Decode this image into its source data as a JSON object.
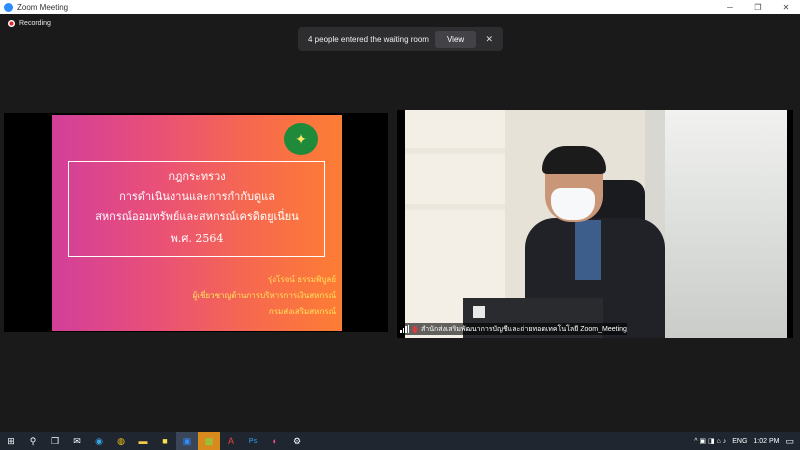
{
  "window": {
    "title": "Zoom Meeting",
    "controls": [
      "─",
      "❐",
      "✕"
    ]
  },
  "recording": {
    "label": "Recording"
  },
  "toast": {
    "message": "4 people entered the waiting room",
    "view_label": "View",
    "close_label": "✕"
  },
  "slide": {
    "logo_glyph": "✦",
    "title_lines": [
      "กฎกระทรวง",
      "การดำเนินงานและการกำกับดูแล",
      "สหกรณ์ออมทรัพย์และสหกรณ์เครดิตยูเนี่ยน",
      "พ.ศ. 2564"
    ],
    "signature_lines": [
      "รุ่งโรจน์ ธรรมพิบูลย์",
      "ผู้เชี่ยวชาญด้านการบริหารการเงินสหกรณ์",
      "กรมส่งเสริมสหกรณ์"
    ]
  },
  "participant": {
    "name": "สำนักส่งเสริมพัฒนาการบัญชีและถ่ายทอดเทคโนโลยี Zoom_Meeting"
  },
  "taskbar": {
    "apps": [
      {
        "icon": "windows-start-icon",
        "glyph": "⊞"
      },
      {
        "icon": "search-icon",
        "glyph": "⚲"
      },
      {
        "icon": "task-view-icon",
        "glyph": "❒"
      },
      {
        "icon": "mail-icon",
        "glyph": "✉"
      },
      {
        "icon": "edge-icon",
        "glyph": "◉"
      },
      {
        "icon": "chrome-icon",
        "glyph": "◍"
      },
      {
        "icon": "file-explorer-icon",
        "glyph": "▬"
      },
      {
        "icon": "sticky-notes-icon",
        "glyph": "■"
      },
      {
        "icon": "zoom-icon",
        "glyph": "▣",
        "active": true
      },
      {
        "icon": "line-icon",
        "glyph": "▩",
        "active": true
      },
      {
        "icon": "acrobat-icon",
        "glyph": "A"
      },
      {
        "icon": "photoshop-icon",
        "glyph": "Ps"
      },
      {
        "icon": "paint-icon",
        "glyph": "◐"
      },
      {
        "icon": "settings-icon",
        "glyph": "⚙"
      }
    ],
    "tray": {
      "icons": "^  ▣  ◨  ⌂  ♪",
      "language": "ENG",
      "time": "1:02 PM",
      "notification_glyph": "▭"
    }
  },
  "colors": {
    "taskbar": "#1f2630",
    "zoom_blue": "#2d8cff",
    "slide_pink": "#d23f9a",
    "slide_orange": "#fd7d34",
    "signature_yellow": "#ffe35a"
  }
}
